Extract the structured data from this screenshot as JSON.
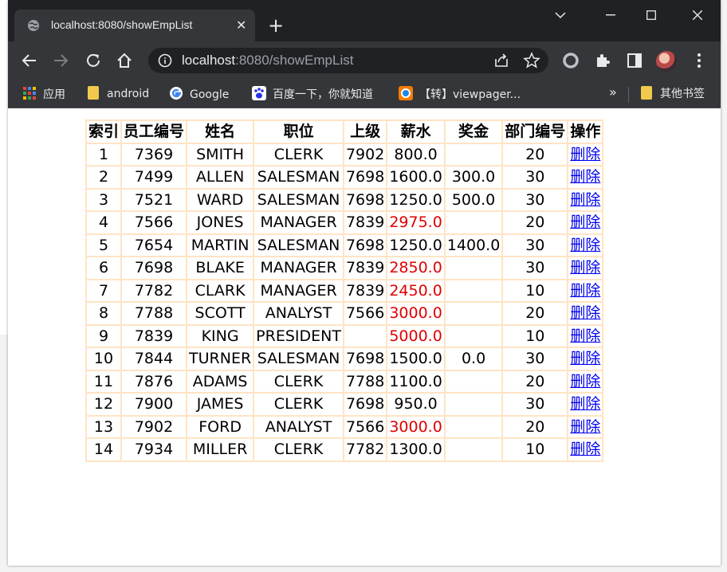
{
  "tab": {
    "title": "localhost:8080/showEmpList",
    "close": "✕"
  },
  "newtab": "+",
  "address": {
    "host": "localhost",
    "rest": ":8080/showEmpList"
  },
  "bookmarks": {
    "apps": "应用",
    "items": [
      "android",
      "Google",
      "百度一下，你就知道",
      "【转】viewpager..."
    ],
    "more": "»",
    "other": "其他书签"
  },
  "colors": {
    "highlight_salary": "#e00000",
    "border": "#ffe4c4",
    "link": "#0000ee"
  },
  "table": {
    "headers": [
      "索引",
      "员工编号",
      "姓名",
      "职位",
      "上级",
      "薪水",
      "奖金",
      "部门编号",
      "操作"
    ],
    "rows": [
      {
        "idx": "1",
        "empno": "7369",
        "ename": "SMITH",
        "job": "CLERK",
        "mgr": "7902",
        "sal": "800.0",
        "comm": "",
        "deptno": "20",
        "op": "删除",
        "highlight": false
      },
      {
        "idx": "2",
        "empno": "7499",
        "ename": "ALLEN",
        "job": "SALESMAN",
        "mgr": "7698",
        "sal": "1600.0",
        "comm": "300.0",
        "deptno": "30",
        "op": "删除",
        "highlight": false
      },
      {
        "idx": "3",
        "empno": "7521",
        "ename": "WARD",
        "job": "SALESMAN",
        "mgr": "7698",
        "sal": "1250.0",
        "comm": "500.0",
        "deptno": "30",
        "op": "删除",
        "highlight": false
      },
      {
        "idx": "4",
        "empno": "7566",
        "ename": "JONES",
        "job": "MANAGER",
        "mgr": "7839",
        "sal": "2975.0",
        "comm": "",
        "deptno": "20",
        "op": "删除",
        "highlight": true
      },
      {
        "idx": "5",
        "empno": "7654",
        "ename": "MARTIN",
        "job": "SALESMAN",
        "mgr": "7698",
        "sal": "1250.0",
        "comm": "1400.0",
        "deptno": "30",
        "op": "删除",
        "highlight": false
      },
      {
        "idx": "6",
        "empno": "7698",
        "ename": "BLAKE",
        "job": "MANAGER",
        "mgr": "7839",
        "sal": "2850.0",
        "comm": "",
        "deptno": "30",
        "op": "删除",
        "highlight": true
      },
      {
        "idx": "7",
        "empno": "7782",
        "ename": "CLARK",
        "job": "MANAGER",
        "mgr": "7839",
        "sal": "2450.0",
        "comm": "",
        "deptno": "10",
        "op": "删除",
        "highlight": true
      },
      {
        "idx": "8",
        "empno": "7788",
        "ename": "SCOTT",
        "job": "ANALYST",
        "mgr": "7566",
        "sal": "3000.0",
        "comm": "",
        "deptno": "20",
        "op": "删除",
        "highlight": true
      },
      {
        "idx": "9",
        "empno": "7839",
        "ename": "KING",
        "job": "PRESIDENT",
        "mgr": "",
        "sal": "5000.0",
        "comm": "",
        "deptno": "10",
        "op": "删除",
        "highlight": true
      },
      {
        "idx": "10",
        "empno": "7844",
        "ename": "TURNER",
        "job": "SALESMAN",
        "mgr": "7698",
        "sal": "1500.0",
        "comm": "0.0",
        "deptno": "30",
        "op": "删除",
        "highlight": false
      },
      {
        "idx": "11",
        "empno": "7876",
        "ename": "ADAMS",
        "job": "CLERK",
        "mgr": "7788",
        "sal": "1100.0",
        "comm": "",
        "deptno": "20",
        "op": "删除",
        "highlight": false
      },
      {
        "idx": "12",
        "empno": "7900",
        "ename": "JAMES",
        "job": "CLERK",
        "mgr": "7698",
        "sal": "950.0",
        "comm": "",
        "deptno": "30",
        "op": "删除",
        "highlight": false
      },
      {
        "idx": "13",
        "empno": "7902",
        "ename": "FORD",
        "job": "ANALYST",
        "mgr": "7566",
        "sal": "3000.0",
        "comm": "",
        "deptno": "20",
        "op": "删除",
        "highlight": true
      },
      {
        "idx": "14",
        "empno": "7934",
        "ename": "MILLER",
        "job": "CLERK",
        "mgr": "7782",
        "sal": "1300.0",
        "comm": "",
        "deptno": "10",
        "op": "删除",
        "highlight": false
      }
    ]
  }
}
